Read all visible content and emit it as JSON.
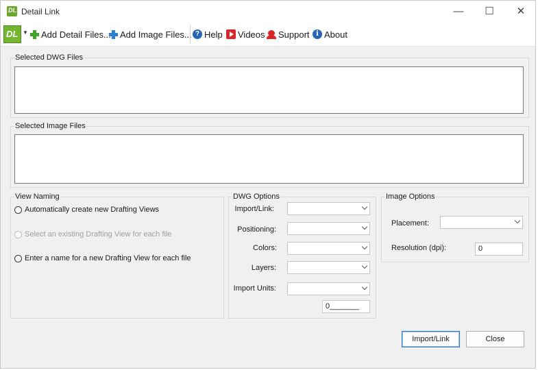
{
  "window": {
    "title": "Detail Link",
    "logo_text": "DL"
  },
  "titlebar": {
    "minimize": "—",
    "maximize": "☐",
    "close": "✕"
  },
  "toolbar": {
    "add_detail_files": "Add Detail Files...",
    "add_image_files": "Add Image Files...",
    "help": "Help",
    "videos": "Videos",
    "support": "Support",
    "about": "About"
  },
  "dwg_files": {
    "label": "Selected DWG Files"
  },
  "image_files": {
    "label": "Selected Image Files"
  },
  "view_naming": {
    "label": "View Naming",
    "options": [
      {
        "label": "Automatically create new Drafting Views",
        "enabled": true
      },
      {
        "label": "Select an existing Drafting View for each file",
        "enabled": false
      },
      {
        "label": "Enter a name for a new Drafting View for each file",
        "enabled": true
      }
    ]
  },
  "dwg_options": {
    "label": "DWG Options",
    "import_link": "Import/Link:",
    "positioning": "Positioning:",
    "colors": "Colors:",
    "layers": "Layers:",
    "import_units": "Import Units:",
    "units_value": "0_______"
  },
  "image_options": {
    "label": "Image Options",
    "placement": "Placement:",
    "resolution": "Resolution (dpi):",
    "resolution_value": "0"
  },
  "buttons": {
    "import_link": "Import/Link",
    "close": "Close"
  }
}
